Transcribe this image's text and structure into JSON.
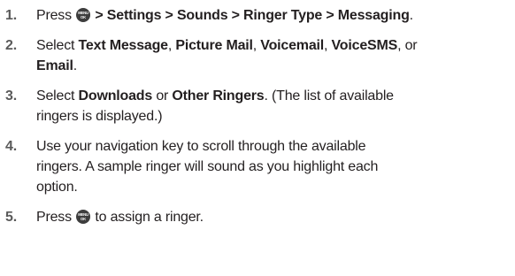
{
  "steps": [
    {
      "number": "1.",
      "press": "Press",
      "menu_path": "> Settings > Sounds > Ringer Type > Messaging",
      "end": "."
    },
    {
      "number": "2.",
      "select": "Select",
      "opt1": "Text Message",
      "sep1": ",",
      "opt2": "Picture Mail",
      "sep2": ",",
      "opt3": "Voicemail",
      "sep3": ",",
      "opt4": "VoiceSMS",
      "sep4": ", or",
      "opt5": "Email",
      "end": "."
    },
    {
      "number": "3.",
      "select": "Select",
      "opt1": "Downloads",
      "or": "or",
      "opt2": "Other Ringers",
      "rest_line1": ". (The list of available",
      "rest_line2": "ringers is displayed.)"
    },
    {
      "number": "4.",
      "line1": "Use your navigation key to scroll through the available",
      "line2": "ringers. A sample ringer will sound as you highlight each",
      "line3": "option."
    },
    {
      "number": "5.",
      "press": "Press",
      "rest": "to assign a ringer."
    }
  ],
  "icon": {
    "name": "menu-ok-key-icon",
    "top_text": "MENU",
    "bottom_text": "OK"
  }
}
